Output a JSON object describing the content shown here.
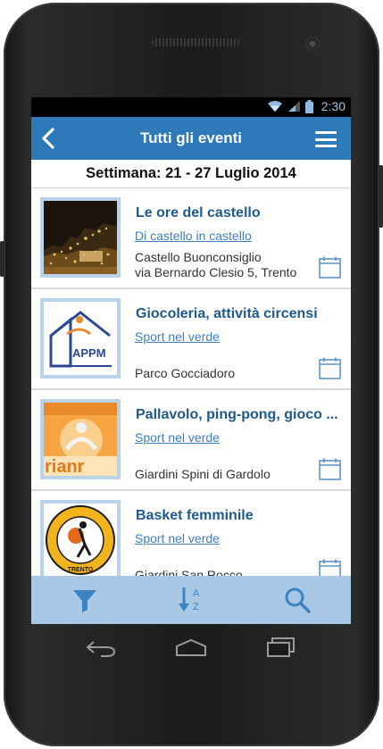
{
  "status": {
    "time": "2:30"
  },
  "header": {
    "title": "Tutti gli eventi"
  },
  "week": {
    "label": "Settimana: 21 - 27 Luglio 2014"
  },
  "events": [
    {
      "title": "Le ore del castello",
      "category": "Di castello in castello",
      "place": "Castello Buonconsiglio\nvia Bernardo Clesio 5, Trento",
      "thumb": "castle-night-photo"
    },
    {
      "title": "Giocoleria, attività circensi",
      "category": "Sport nel verde",
      "place": "Parco Gocciadoro",
      "thumb": "appm-logo",
      "thumb_text": "APPM"
    },
    {
      "title": "Pallavolo, ping-pong, gioco ...",
      "category": "Sport nel verde",
      "place": "Giardini Spini di Gardolo",
      "thumb": "cooperativa-logo",
      "thumb_text": "rianr"
    },
    {
      "title": "Basket femminile",
      "category": "Sport nel verde",
      "place": "Giardini San Rocco",
      "thumb": "belvedere-basket-logo",
      "thumb_text": "TRENTO"
    }
  ],
  "toolbar": {
    "icons": [
      "filter-icon",
      "sort-az-icon",
      "search-icon"
    ],
    "sort_letters": [
      "A",
      "Z"
    ]
  },
  "colors": {
    "primary": "#2e7ab9",
    "title": "#1f5a8e",
    "link": "#3f7fbf",
    "toolbar": "#a9c8e6"
  }
}
